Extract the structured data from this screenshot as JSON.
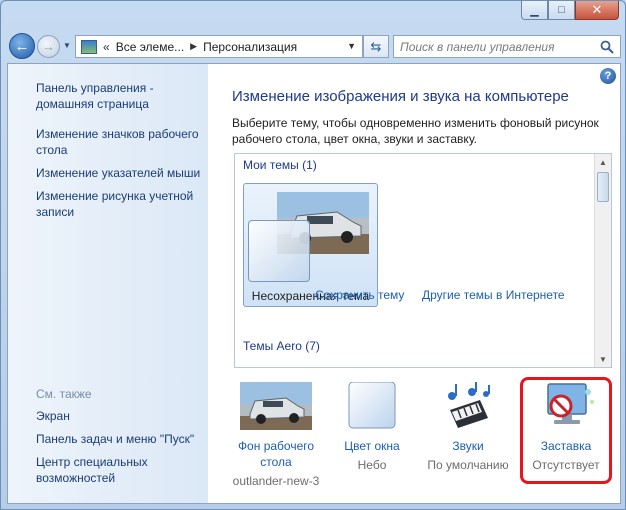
{
  "window": {
    "minimize_icon": "minimize-icon",
    "maximize_icon": "maximize-icon",
    "close_icon": "close-icon"
  },
  "nav": {
    "back_icon": "back-arrow-icon",
    "forward_icon": "forward-arrow-icon",
    "breadcrumb": [
      "Все элеме...",
      "Персонализация"
    ],
    "search_placeholder": "Поиск в панели управления"
  },
  "sidebar": {
    "items": [
      "Панель управления - домашняя страница",
      "Изменение значков рабочего стола",
      "Изменение указателей мыши",
      "Изменение рисунка учетной записи"
    ],
    "see_also_label": "См. также",
    "see_also": [
      "Экран",
      "Панель задач и меню \"Пуск\"",
      "Центр специальных возможностей"
    ]
  },
  "main": {
    "title": "Изменение изображения и звука на компьютере",
    "description": "Выберите тему, чтобы одновременно изменить фоновый рисунок рабочего стола, цвет окна, звуки и заставку.",
    "my_themes_label": "Мои темы (1)",
    "unsaved_theme": "Несохраненная тема",
    "save_theme_link": "Сохранить тему",
    "other_themes_link": "Другие темы в Интернете",
    "aero_themes_label": "Темы Aero (7)"
  },
  "bottom": [
    {
      "label": "Фон рабочего стола",
      "sub": "outlander-new-3",
      "icon": "wallpaper-photo"
    },
    {
      "label": "Цвет окна",
      "sub": "Небо",
      "icon": "window-color-swatch"
    },
    {
      "label": "Звуки",
      "sub": "По умолчанию",
      "icon": "sounds-music-icon"
    },
    {
      "label": "Заставка",
      "sub": "Отсутствует",
      "icon": "screensaver-none-icon"
    }
  ],
  "colors": {
    "link": "#1b5fb4",
    "title": "#1e3a8a",
    "highlight": "#e8141e"
  }
}
